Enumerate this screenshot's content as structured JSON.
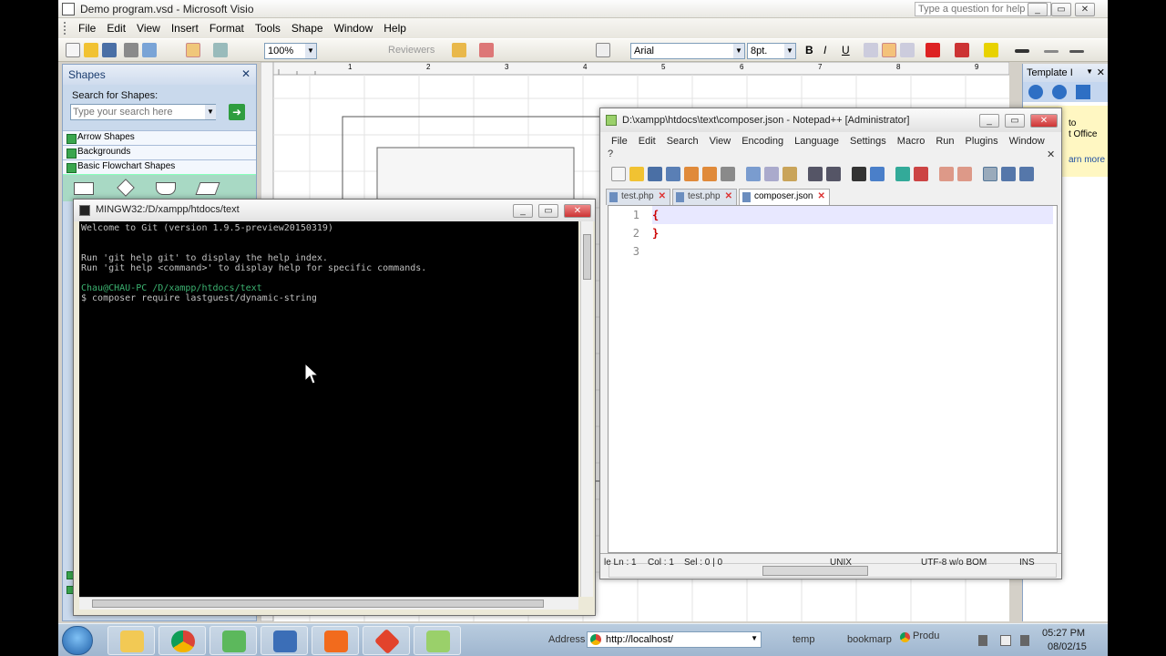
{
  "visio": {
    "title": "Demo program.vsd - Microsoft Visio",
    "menu": [
      "File",
      "Edit",
      "View",
      "Insert",
      "Format",
      "Tools",
      "Shape",
      "Window",
      "Help"
    ],
    "help_placeholder": "Type a question for help",
    "zoom": "100%",
    "reviewers": "Reviewers",
    "font": "Arial",
    "font_size": "8pt.",
    "shapes_title": "Shapes",
    "search_label": "Search for Shapes:",
    "search_placeholder": "Type your search here",
    "stencils": [
      "Arrow Shapes",
      "Backgrounds",
      "Basic Flowchart Shapes"
    ],
    "template_title": "Template I",
    "template_texts": [
      "to",
      "t Office",
      "arn more"
    ],
    "ruler_ticks": [
      "1",
      "2",
      "3",
      "4",
      "5",
      "6",
      "7",
      "8",
      "9"
    ]
  },
  "git": {
    "title": "MINGW32:/D/xampp/htdocs/text",
    "lines": [
      {
        "text": "Welcome to Git (version 1.9.5-preview20150319)",
        "color": "#c0c0c0"
      },
      {
        "text": "",
        "color": "#c0c0c0"
      },
      {
        "text": "",
        "color": "#c0c0c0"
      },
      {
        "text": "Run 'git help git' to display the help index.",
        "color": "#c0c0c0"
      },
      {
        "text": "Run 'git help <command>' to display help for specific commands.",
        "color": "#c0c0c0"
      },
      {
        "text": "",
        "color": "#c0c0c0"
      },
      {
        "text": "Chau@CHAU-PC /D/xampp/htdocs/text",
        "color": "#3cb371"
      },
      {
        "text": "$ composer require lastguest/dynamic-string",
        "color": "#c0c0c0"
      }
    ]
  },
  "npp": {
    "title": "D:\\xampp\\htdocs\\text\\composer.json - Notepad++ [Administrator]",
    "menu": [
      "File",
      "Edit",
      "Search",
      "View",
      "Encoding",
      "Language",
      "Settings",
      "Macro",
      "Run",
      "Plugins",
      "Window"
    ],
    "menu_extra": "?",
    "tabs": [
      "test.php",
      "test.php",
      "composer.json"
    ],
    "line_numbers": [
      "1",
      "2",
      "3"
    ],
    "code_lines": [
      "{",
      "}",
      ""
    ],
    "status": {
      "ln": "le Ln : 1",
      "col": "Col : 1",
      "sel": "Sel : 0 | 0",
      "eol": "UNIX",
      "encoding": "UTF-8 w/o BOM",
      "mode": "INS"
    }
  },
  "taskbar": {
    "address_label": "Address",
    "address_value": "http://localhost/",
    "toolbars": [
      "temp",
      "bookmarp",
      "Produ"
    ],
    "time": "05:27 PM",
    "date": "08/02/15"
  },
  "colors": {
    "git_prompt": "#3cb371",
    "json_brace": "#cc0000",
    "visio_pane": "#c9d9ec"
  }
}
